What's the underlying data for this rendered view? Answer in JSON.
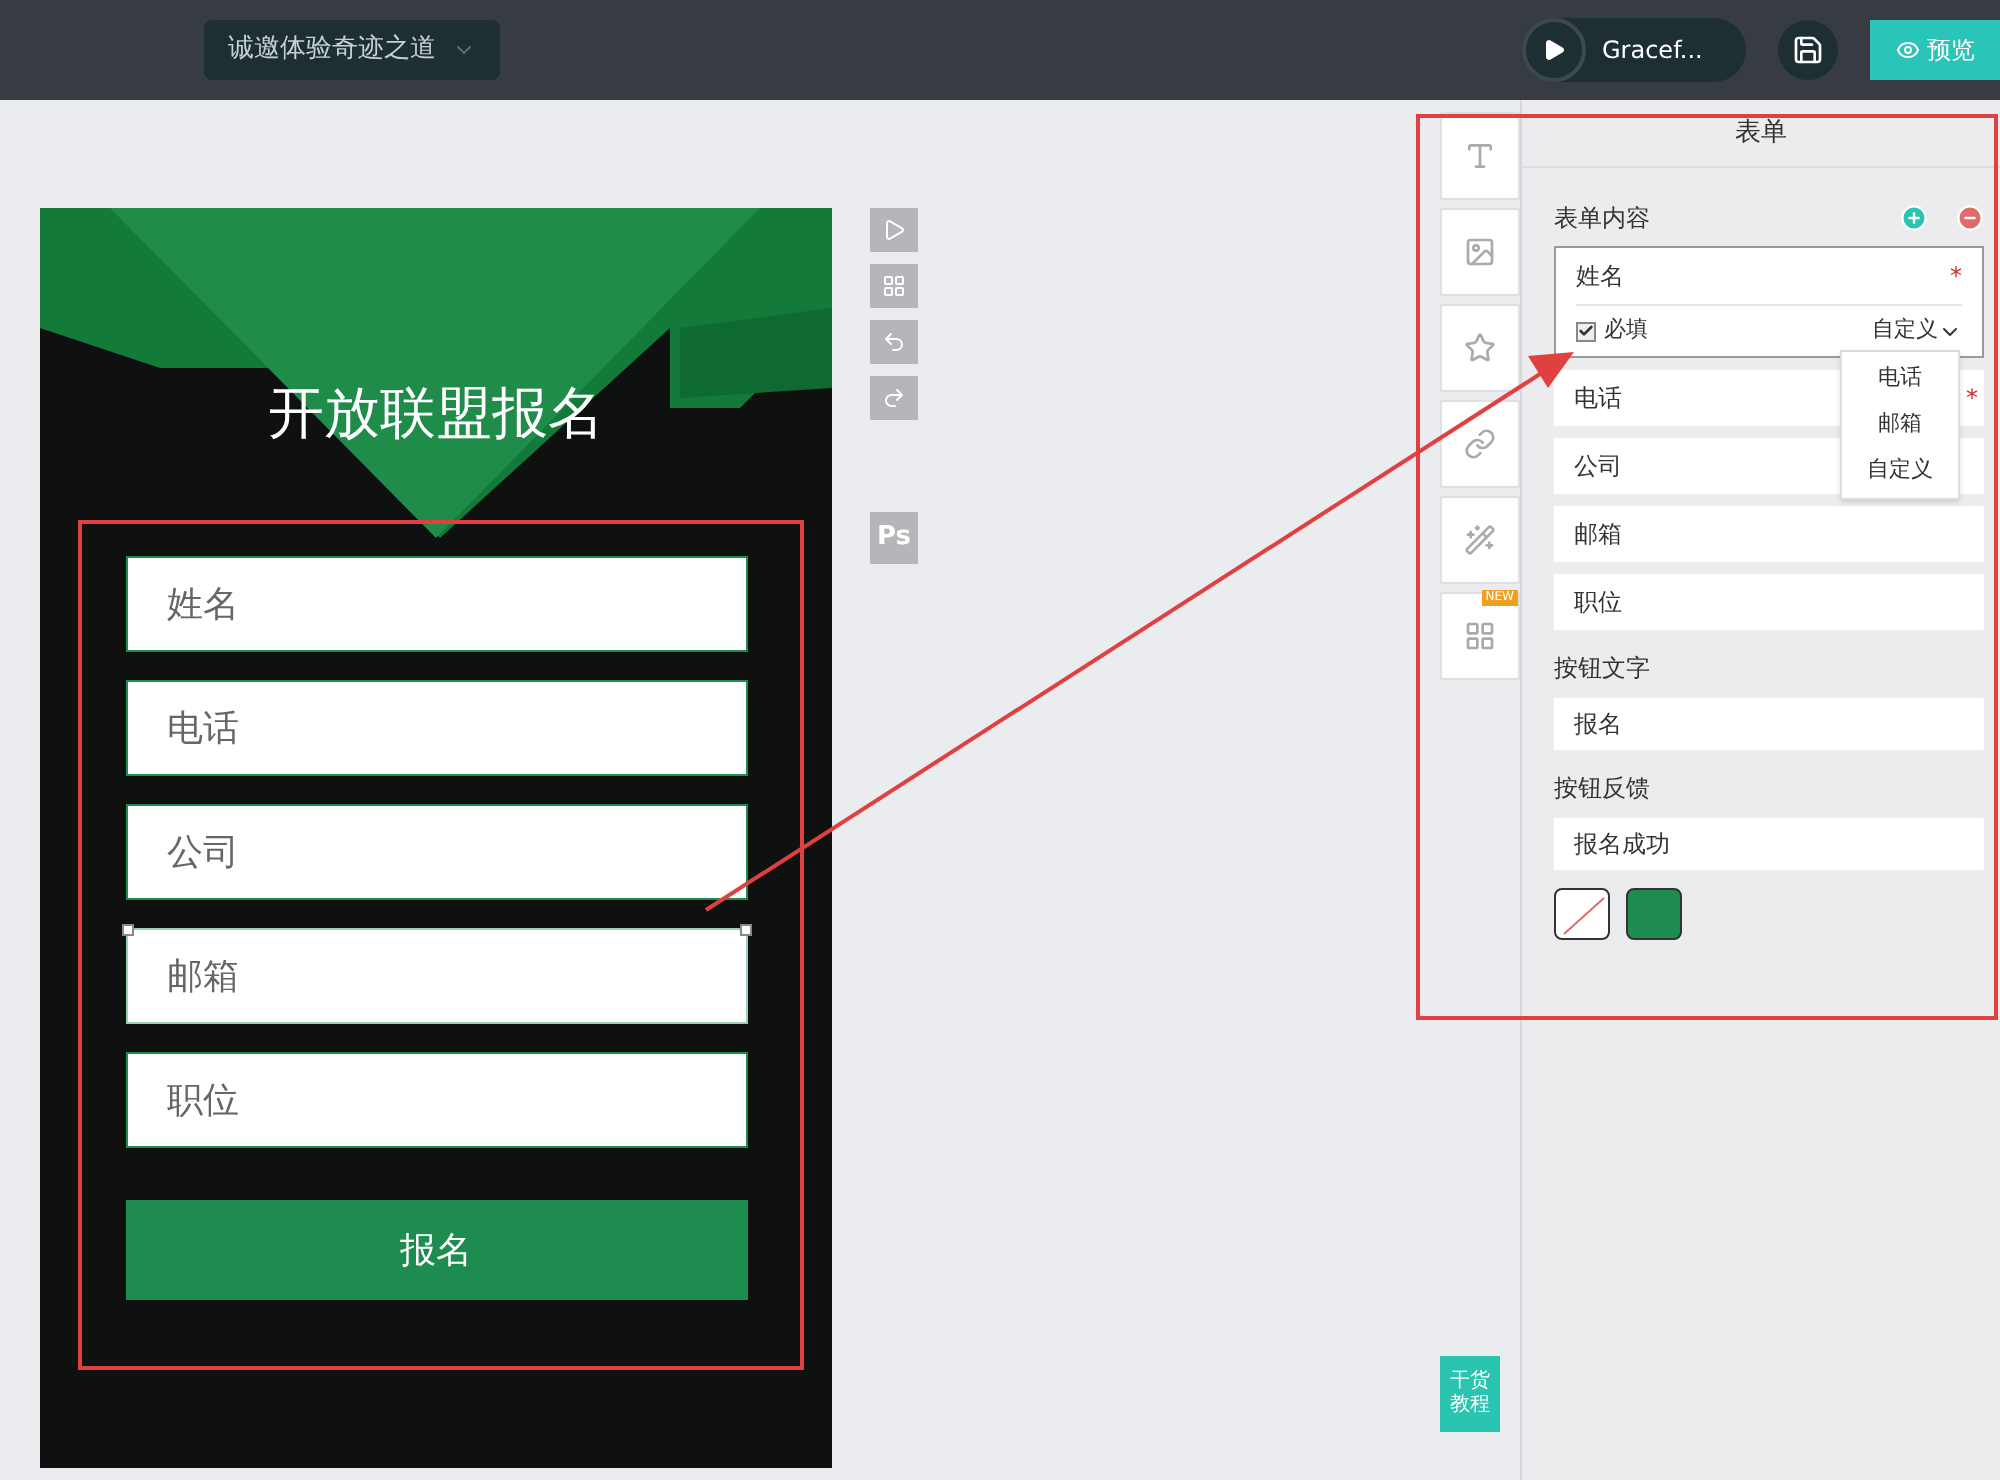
{
  "topbar": {
    "project": "诚邀体验奇迹之道",
    "music": "Gracef...",
    "preview": "预览"
  },
  "phone": {
    "title": "开放联盟报名",
    "fields": [
      {
        "placeholder": "姓名",
        "selected": false
      },
      {
        "placeholder": "电话",
        "selected": false
      },
      {
        "placeholder": "公司",
        "selected": false
      },
      {
        "placeholder": "邮箱",
        "selected": true
      },
      {
        "placeholder": "职位",
        "selected": false
      }
    ],
    "submit": "报名"
  },
  "canvas_tools": {
    "ps_label": "Ps"
  },
  "widget_tools": {
    "new_badge": "NEW"
  },
  "panel": {
    "title": "表单",
    "section": "表单内容",
    "items": [
      {
        "label": "姓名",
        "required": true,
        "expanded": true,
        "required_label": "必填",
        "checked": true,
        "type_label": "自定义"
      },
      {
        "label": "电话",
        "required": true,
        "expanded": false
      },
      {
        "label": "公司",
        "required": false,
        "expanded": false
      },
      {
        "label": "邮箱",
        "required": false,
        "expanded": false
      },
      {
        "label": "职位",
        "required": false,
        "expanded": false
      }
    ],
    "required_mark": "*",
    "dropdown": [
      "电话",
      "邮箱",
      "自定义"
    ],
    "button_text_label": "按钮文字",
    "button_text": "报名",
    "feedback_label": "按钮反馈",
    "feedback": "报名成功",
    "colors": [
      {
        "kind": "none"
      },
      {
        "kind": "fill",
        "color": "#1e8c4e"
      }
    ]
  },
  "help_badge": "干货教程"
}
